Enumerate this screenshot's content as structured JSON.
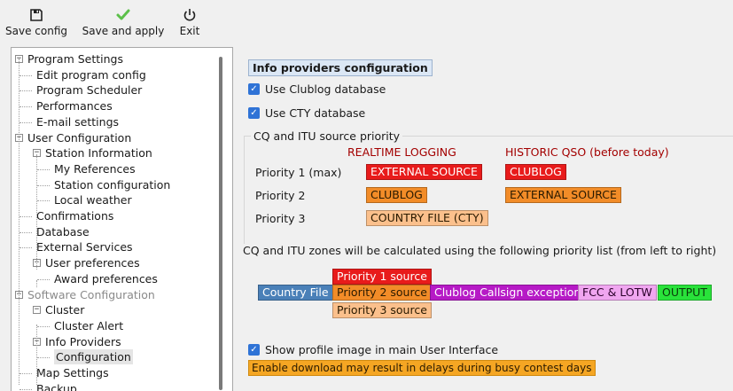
{
  "toolbar": {
    "save_config": {
      "label": "Save config",
      "icon": "floppy-disk-icon"
    },
    "save_apply": {
      "label": "Save and apply",
      "icon": "checkmark-icon"
    },
    "exit": {
      "label": "Exit",
      "icon": "power-icon"
    }
  },
  "tree": {
    "items": [
      {
        "label": "Program Settings",
        "level": 0,
        "expander": "−"
      },
      {
        "label": "Edit program config",
        "level": 1
      },
      {
        "label": "Program Scheduler",
        "level": 1
      },
      {
        "label": "Performances",
        "level": 1
      },
      {
        "label": "E-mail settings",
        "level": 1
      },
      {
        "label": "User Configuration",
        "level": 0,
        "expander": "−"
      },
      {
        "label": "Station Information",
        "level": 1,
        "expander": "−"
      },
      {
        "label": "My References",
        "level": 2
      },
      {
        "label": "Station configuration",
        "level": 2
      },
      {
        "label": "Local weather",
        "level": 2
      },
      {
        "label": "Confirmations",
        "level": 1
      },
      {
        "label": "Database",
        "level": 1
      },
      {
        "label": "External Services",
        "level": 1
      },
      {
        "label": "User preferences",
        "level": 1,
        "expander": "−"
      },
      {
        "label": "Award preferences",
        "level": 2
      },
      {
        "label": "Software Configuration",
        "level": 0,
        "expander": "−",
        "disabled": true
      },
      {
        "label": "Cluster",
        "level": 1,
        "expander": "−"
      },
      {
        "label": "Cluster Alert",
        "level": 2
      },
      {
        "label": "Info Providers",
        "level": 1,
        "expander": "−"
      },
      {
        "label": "Configuration",
        "level": 2,
        "selected": true
      },
      {
        "label": "Map Settings",
        "level": 1
      },
      {
        "label": "Backup",
        "level": 1
      }
    ]
  },
  "main": {
    "section_title": "Info providers configuration",
    "use_clublog": {
      "label": "Use Clublog database",
      "checked": true
    },
    "use_cty": {
      "label": "Use CTY database",
      "checked": true
    },
    "priority_group": {
      "title": "CQ and ITU source priority",
      "col_realtime": "REALTIME LOGGING",
      "col_historic": "HISTORIC QSO (before today)",
      "rows": [
        {
          "label": "Priority 1 (max)",
          "realtime": "EXTERNAL SOURCE",
          "historic": "CLUBLOG"
        },
        {
          "label": "Priority 2",
          "realtime": "CLUBLOG",
          "historic": "EXTERNAL SOURCE"
        },
        {
          "label": "Priority 3",
          "realtime": "COUNTRY FILE (CTY)"
        }
      ]
    },
    "zones_text": "CQ and ITU zones will be calculated using the following priority list (from left to right)",
    "flow": {
      "country_file": "Country File",
      "priority1": "Priority 1 source",
      "priority2": "Priority 2 source",
      "priority3": "Priority 3 source",
      "clublog_exception": "Clublog Callsign exception",
      "fcc_lotw": "FCC & LOTW",
      "output": "OUTPUT"
    },
    "show_profile": {
      "label": "Show profile image in main User Interface",
      "checked": true
    },
    "warning": "Enable download may result in delays during busy contest days"
  },
  "colors": {
    "red": "#e81b1b",
    "orange": "#f28c28",
    "peach": "#fbc08c",
    "blue": "#4a80b8",
    "purple": "#b61ac6",
    "pink": "#f0a6f0",
    "green": "#29e23a",
    "checkbox": "#2f73d6",
    "warning": "#f5a623"
  }
}
